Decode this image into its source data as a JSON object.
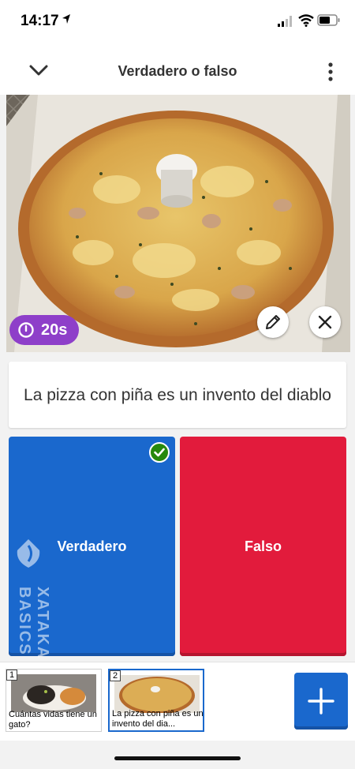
{
  "status_bar": {
    "time": "14:17"
  },
  "header": {
    "title": "Verdadero o falso"
  },
  "media": {
    "timer_label": "20s"
  },
  "question": {
    "text": "La pizza con piña es un invento del diablo"
  },
  "answers": [
    {
      "label": "Verdadero",
      "color": "#1a68cd",
      "correct": true
    },
    {
      "label": "Falso",
      "color": "#e21b3c",
      "correct": false
    }
  ],
  "watermark": {
    "text": "XATAKA BASICS"
  },
  "slides": [
    {
      "number": "1",
      "title": "Cuántas vidas tiene un gato?"
    },
    {
      "number": "2",
      "title": "La pizza con piña es un invento del dia...",
      "selected": true
    }
  ],
  "colors": {
    "timer": "#8e3fc9",
    "accent_blue": "#1a68cd",
    "accent_red": "#e21b3c",
    "correct_green": "#26890c"
  },
  "icons": [
    "location-arrow-icon",
    "signal-icon",
    "wifi-icon",
    "battery-icon",
    "chevron-down-icon",
    "more-vertical-icon",
    "timer-icon",
    "pencil-icon",
    "close-icon",
    "check-icon",
    "plus-icon"
  ]
}
